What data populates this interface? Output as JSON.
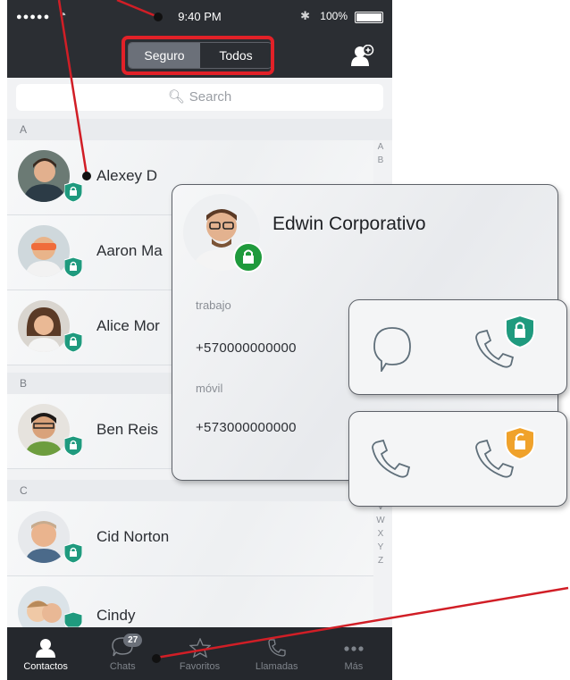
{
  "status_bar": {
    "signal": "●●●●●",
    "time": "9:40 PM",
    "battery": "100%"
  },
  "segmented": {
    "secure": "Seguro",
    "all": "Todos"
  },
  "search": {
    "placeholder": "Search"
  },
  "sections": [
    "A",
    "B",
    "C"
  ],
  "contacts": [
    {
      "name": "Alexey D"
    },
    {
      "name": "Aaron Ma"
    },
    {
      "name": "Alice Mor"
    },
    {
      "name": "Ben Reis"
    },
    {
      "name": "Cid Norton"
    },
    {
      "name": "Cindy"
    }
  ],
  "index_top": [
    "A",
    "B"
  ],
  "index_bottom": [
    "V",
    "W",
    "X",
    "Y",
    "Z"
  ],
  "tabs": [
    {
      "label": "Contactos",
      "icon": "person-icon"
    },
    {
      "label": "Chats",
      "icon": "chat-bubble-icon"
    },
    {
      "label": "Favoritos",
      "icon": "star-icon"
    },
    {
      "label": "Llamadas",
      "icon": "phone-icon"
    },
    {
      "label": "Más",
      "icon": "more-dots-icon"
    }
  ],
  "chats_badge": "27",
  "contact_card": {
    "name": "Edwin Corporativo",
    "work_label": "trabajo",
    "work_number": "+570000000000",
    "mobile_label": "móvil",
    "mobile_number": "+573000000000"
  },
  "colors": {
    "dark_bar": "#2b2e33",
    "secure_green": "#1f9a7e",
    "unsecure_orange": "#f0a22b",
    "annotation_red": "#e22128"
  }
}
